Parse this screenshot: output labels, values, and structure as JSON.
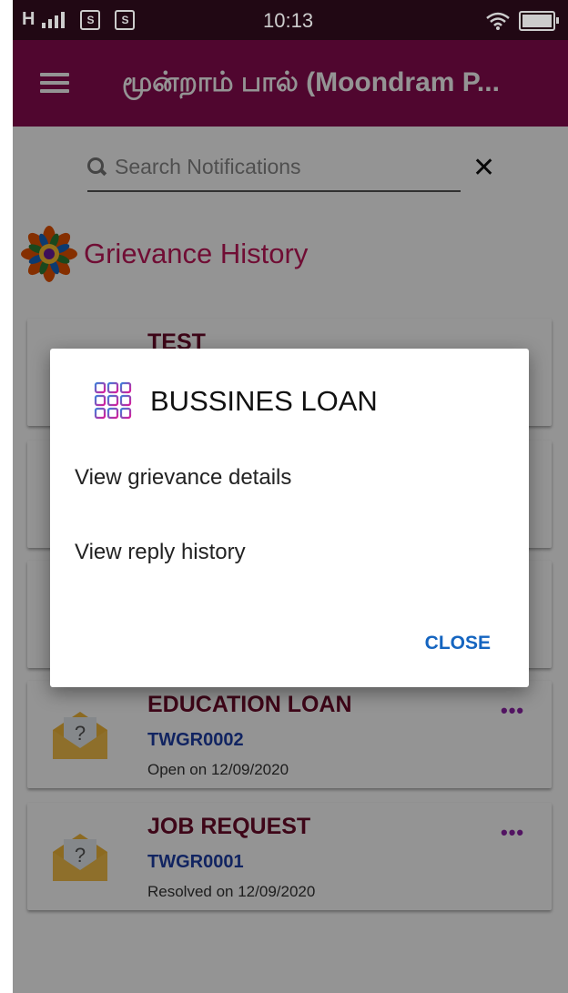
{
  "status_bar": {
    "signal": "H",
    "sim1": "S",
    "sim2": "S",
    "time": "10:13"
  },
  "app_bar": {
    "title": "மூன்றாம் பால் (Moondram P..."
  },
  "search": {
    "placeholder": "Search Notifications",
    "clear": "✕"
  },
  "section": {
    "title": "Grievance History"
  },
  "cards": [
    {
      "title": "TEST",
      "code": "",
      "status": ""
    },
    {
      "title": "EDUCATION LOAN",
      "code": "TWGR0002",
      "status": "Open on 12/09/2020",
      "more": "•••"
    },
    {
      "title": "JOB REQUEST",
      "code": "TWGR0001",
      "status": "Resolved on 12/09/2020",
      "more": "•••"
    }
  ],
  "dialog": {
    "title": "BUSSINES LOAN",
    "items": [
      "View grievance details",
      "View reply history"
    ],
    "close_label": "CLOSE"
  },
  "colors": {
    "app_bar": "#8b0b52",
    "status_bar": "#2a0a1a",
    "section_title": "#c2185b",
    "card_code": "#1e3ea8",
    "accent_button": "#1565c0"
  }
}
